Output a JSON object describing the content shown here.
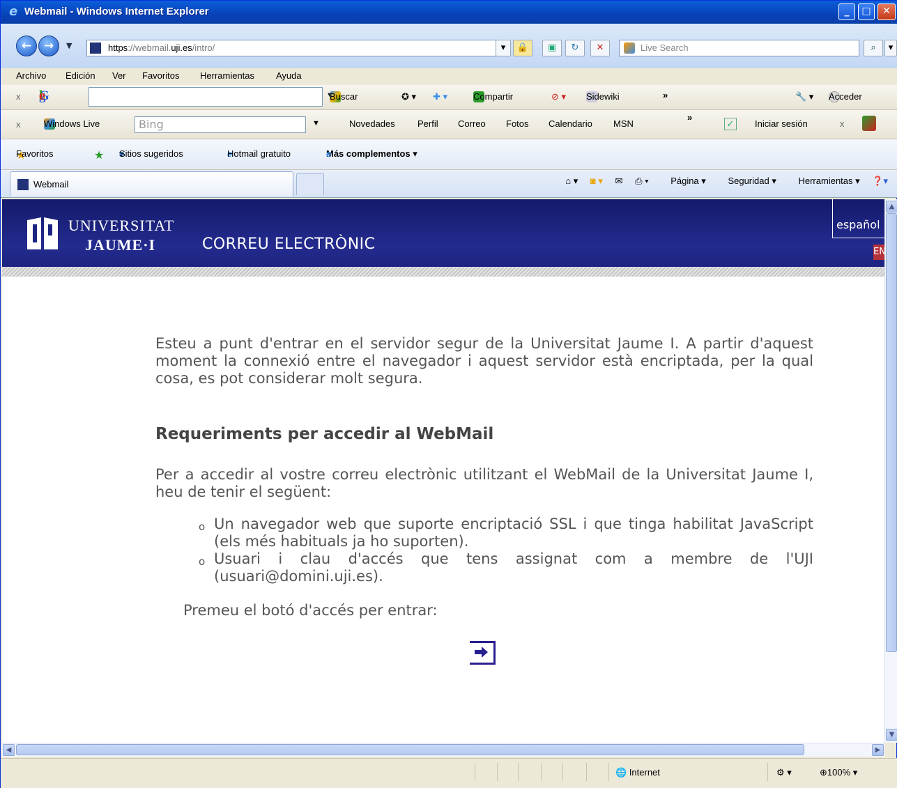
{
  "window": {
    "title": "Webmail - Windows Internet Explorer"
  },
  "address": {
    "url_prefix": "https",
    "url_rest": "://webmail.",
    "url_bold": "uji.es",
    "url_path": "/intro/",
    "search_placeholder": "Live Search"
  },
  "menu": [
    "Archivo",
    "Edición",
    "Ver",
    "Favoritos",
    "Herramientas",
    "Ayuda"
  ],
  "google_toolbar": {
    "logo": "Google",
    "buscar": "Buscar",
    "compartir": "Compartir",
    "sidewiki": "Sidewiki",
    "acceder": "Acceder",
    "more": "»"
  },
  "live_toolbar": {
    "brand": "Windows Live",
    "search_placeholder": "Bing",
    "links": [
      "Novedades",
      "Perfil",
      "Correo",
      "Fotos",
      "Calendario",
      "MSN"
    ],
    "more": "»",
    "signin": "Iniciar sesión"
  },
  "favorites_bar": {
    "favoritos": "Favoritos",
    "sitios": "Sitios sugeridos",
    "hotmail": "Hotmail gratuito",
    "complementos": "Más complementos"
  },
  "tab": {
    "label": "Webmail"
  },
  "command_bar": {
    "pagina": "Página",
    "seguridad": "Seguridad",
    "herramientas": "Herramientas"
  },
  "page": {
    "uni_line1": "UNIVERSITAT",
    "uni_line2": "JAUME·I",
    "title": "CORREU ELECTRÒNIC",
    "language": "español",
    "lang_badge": "EN",
    "intro": "Esteu a punt d'entrar en el servidor segur de la Universitat Jaume I. A partir d'aquest moment la connexió entre el navegador i aquest servidor està encriptada, per la qual cosa, es pot considerar molt segura.",
    "req_heading": "Requeriments per accedir al WebMail",
    "req_intro": "Per a accedir al vostre correu electrònic utilitzant el WebMail de la Universitat Jaume I, heu de tenir el següent:",
    "requirements": [
      "Un navegador web que suporte encriptació SSL i que tinga habilitat JavaScript (els més habituals ja ho suporten).",
      "Usuari i clau d'accés que tens assignat com a membre de l'UJI (usuari@domini.uji.es)."
    ],
    "press": "Premeu el botó d'accés per entrar:"
  },
  "status": {
    "zone": "Internet",
    "zoom": "100%"
  },
  "colors": {
    "header": "#1c2380",
    "accent": "#2a1f8e",
    "badge": "#b5333a"
  }
}
